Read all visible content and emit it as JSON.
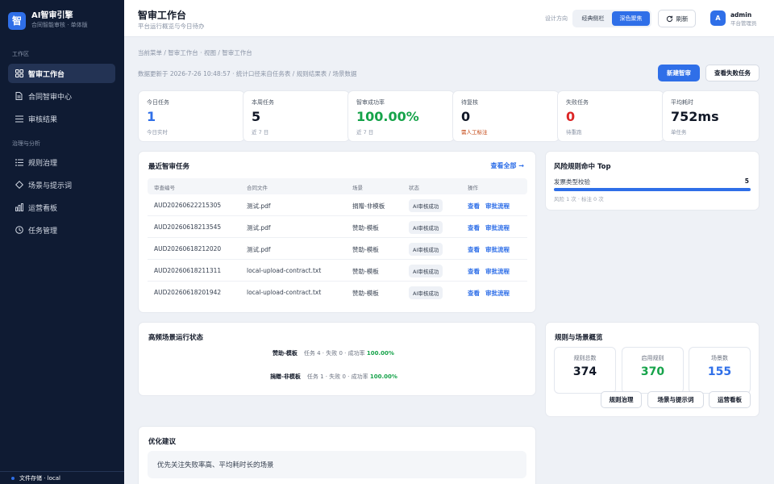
{
  "brand": {
    "logo": "智",
    "title": "AI智审引擎",
    "subtitle": "合同智能审核 · 单体版"
  },
  "sidebar": {
    "section_work": "工作区",
    "section_gov": "治理与分析",
    "items": [
      {
        "label": "智审工作台",
        "icon": "grid-icon",
        "active": true
      },
      {
        "label": "合同智审中心",
        "icon": "document-icon",
        "active": false
      },
      {
        "label": "审核结果",
        "icon": "list-icon",
        "active": false
      },
      {
        "label": "规则治理",
        "icon": "rule-list-icon",
        "active": false
      },
      {
        "label": "场景与提示词",
        "icon": "diamond-icon",
        "active": false
      },
      {
        "label": "运营看板",
        "icon": "bar-chart-icon",
        "active": false
      },
      {
        "label": "任务管理",
        "icon": "clock-icon",
        "active": false
      }
    ],
    "footer": "文件存储 · local"
  },
  "header": {
    "title": "智审工作台",
    "subtitle": "平台运行概览与今日待办",
    "design_label": "设计方向",
    "seg_options": [
      "经典侧栏",
      "深色聚焦"
    ],
    "refresh": "刷新",
    "avatar": "A",
    "user_name": "admin",
    "user_role": "平台管理员"
  },
  "breadcrumb": "当前菜单 / 智审工作台  ·  视图 / 智审工作台",
  "updated": "数据更新于 2026-7-26 10:48:57 · 统计口径来自任务表 / 规则结果表 / 场景数据",
  "actions": {
    "new": "新建智审",
    "failed": "查看失败任务"
  },
  "stats": [
    {
      "label": "今日任务",
      "value": "1",
      "note": "今日实时",
      "color": "#2f6fe8"
    },
    {
      "label": "本周任务",
      "value": "5",
      "note": "近 7 日",
      "color": "#111827"
    },
    {
      "label": "智审成功率",
      "value": "100.00%",
      "note": "近 7 日",
      "color": "#16a34a"
    },
    {
      "label": "待复核",
      "value": "0",
      "note": "需人工标注",
      "color": "#111827",
      "note_color": "#c2410c"
    },
    {
      "label": "失败任务",
      "value": "0",
      "note": "待重跑",
      "color": "#dc2626"
    },
    {
      "label": "平均耗时",
      "value": "752ms",
      "note": "单任务",
      "color": "#111827"
    }
  ],
  "recent": {
    "title": "最近智审任务",
    "view_all": "查看全部 →",
    "columns": [
      "审查编号",
      "合同文件",
      "场景",
      "状态",
      "操作"
    ],
    "rows": [
      {
        "id": "AUD20260622215305",
        "file": "测试.pdf",
        "scene": "捐赠-非模板",
        "status": "AI审核成功"
      },
      {
        "id": "AUD20260618213545",
        "file": "测试.pdf",
        "scene": "赞助-模板",
        "status": "AI审核成功"
      },
      {
        "id": "AUD20260618212020",
        "file": "测试.pdf",
        "scene": "赞助-模板",
        "status": "AI审核成功"
      },
      {
        "id": "AUD20260618211311",
        "file": "local-upload-contract.txt",
        "scene": "赞助-模板",
        "status": "AI审核成功"
      },
      {
        "id": "AUD20260618201942",
        "file": "local-upload-contract.txt",
        "scene": "赞助-模板",
        "status": "AI审核成功"
      }
    ],
    "action_view": "查看",
    "action_flow": "审批流程"
  },
  "risk": {
    "title": "风险规则命中 Top",
    "items": [
      {
        "name": "发票类型校验",
        "count": "5",
        "fill": 1.0,
        "note": "风险 1 次 · 标注 0 次"
      }
    ]
  },
  "scenarios": {
    "title": "高频场景运行状态",
    "items": [
      {
        "name": "赞助-模板",
        "stats": "任务 4 · 失败 0 · 成功率",
        "rate": "100.00%"
      },
      {
        "name": "捐赠-非模板",
        "stats": "任务 1 · 失败 0 · 成功率",
        "rate": "100.00%"
      }
    ]
  },
  "overview": {
    "title": "规则与场景概览",
    "boxes": [
      {
        "label": "规则总数",
        "value": "374",
        "color": "#111827"
      },
      {
        "label": "启用规则",
        "value": "370",
        "color": "#16a34a"
      },
      {
        "label": "场景数",
        "value": "155",
        "color": "#2f6fe8"
      }
    ],
    "buttons": [
      "规则治理",
      "场景与提示词",
      "运营看板"
    ]
  },
  "suggest": {
    "title": "优化建议",
    "text": "优先关注失败率高、平均耗时长的场景"
  }
}
